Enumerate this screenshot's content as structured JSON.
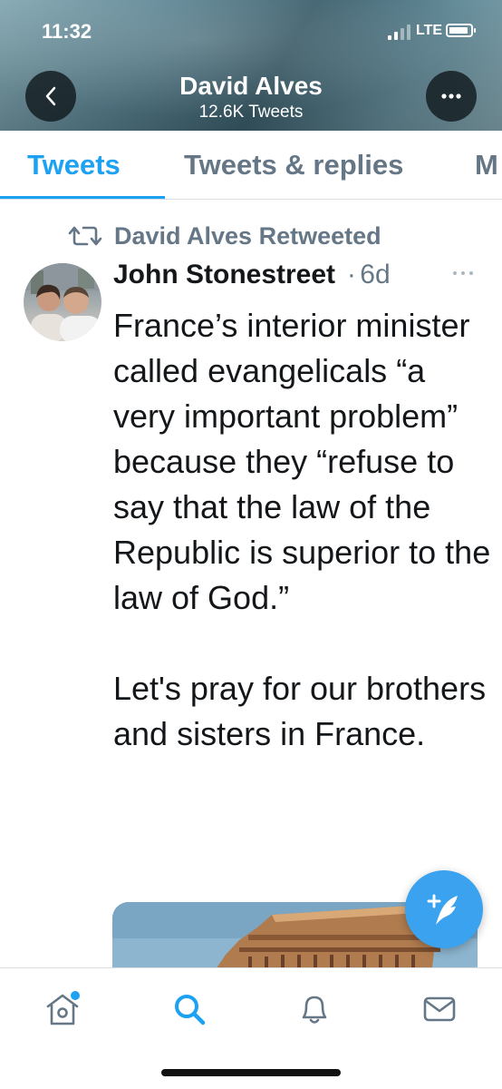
{
  "status_bar": {
    "time": "11:32",
    "network": "LTE"
  },
  "header": {
    "name": "David Alves",
    "tweet_count": "12.6K Tweets"
  },
  "tabs": [
    {
      "label": "Tweets",
      "active": true
    },
    {
      "label": "Tweets & replies",
      "active": false
    },
    {
      "label": "M",
      "active": false
    }
  ],
  "tweet": {
    "retweet_label": "David Alves Retweeted",
    "author": "John Stonestreet",
    "time_ago": "6d",
    "paragraphs": [
      "France’s interior minister called evangelicals “a very important problem” because they “refuse to say that the law of the Republic is superior to the law of God.”",
      "Let's pray for our brothers and sisters in France."
    ]
  },
  "colors": {
    "accent": "#1da1f2",
    "secondary_text": "#657786",
    "fab": "#3aa2ee"
  },
  "icons": {
    "back": "chevron-left-icon",
    "more": "ellipsis-icon",
    "retweet": "retweet-icon",
    "compose": "compose-icon",
    "home": "home-icon",
    "search": "search-icon",
    "notifications": "bell-icon",
    "messages": "mail-icon"
  }
}
